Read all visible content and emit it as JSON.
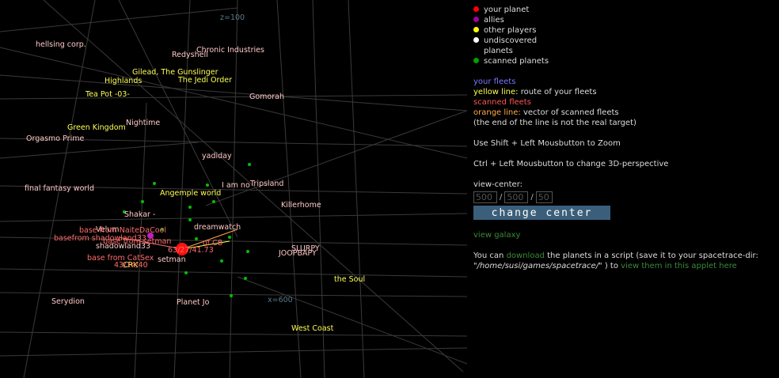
{
  "axis_labels": {
    "z": "z=100",
    "x": "x=600"
  },
  "planets": [
    {
      "name": "hellsing corp.",
      "color": "#ffc8c8"
    },
    {
      "name": "Chronic Industries",
      "color": "#ffc8c8"
    },
    {
      "name": "Redyshell",
      "color": "#ffc8c8"
    },
    {
      "name": "Gilead, The Gunslinger",
      "color": "#ffff55"
    },
    {
      "name": "Highlands",
      "color": "#ffff55"
    },
    {
      "name": "The Jedi Order",
      "color": "#ffff55"
    },
    {
      "name": "Tea Pot -03-",
      "color": "#ffff55"
    },
    {
      "name": "Gomorah",
      "color": "#ffc8c8"
    },
    {
      "name": "Nightime",
      "color": "#ffc8c8"
    },
    {
      "name": "Green Kingdom",
      "color": "#ffff55"
    },
    {
      "name": "Orgasmo Prime",
      "color": "#ffc8c8"
    },
    {
      "name": "yadiday",
      "color": "#ffc8c8"
    },
    {
      "name": "Tripsland",
      "color": "#ffc8c8"
    },
    {
      "name": "I am no",
      "color": "#ffc8c8"
    },
    {
      "name": "final fantasy world",
      "color": "#ffc8c8"
    },
    {
      "name": "Angemple world",
      "color": "#ffff55"
    },
    {
      "name": "Killerhome",
      "color": "#ffc8c8"
    },
    {
      "name": "Shakar -",
      "color": "#ffc8c8"
    },
    {
      "name": "dreamwatch",
      "color": "#ffc8c8"
    },
    {
      "name": "Velum",
      "color": "#ffc8c8"
    },
    {
      "name": "shadowland33",
      "color": "#ffc8c8"
    },
    {
      "name": "SLURPY",
      "color": "#ffc8c8"
    },
    {
      "name": "JOOPBAPY",
      "color": "#ffc8c8"
    },
    {
      "name": "CRK",
      "color": "#ffff55"
    },
    {
      "name": "setman",
      "color": "#ffc8c8"
    },
    {
      "name": "the Soul",
      "color": "#ffff55"
    },
    {
      "name": "Serydion",
      "color": "#ffc8c8"
    },
    {
      "name": "Planet Jo",
      "color": "#ffc8c8"
    },
    {
      "name": "West Coast",
      "color": "#ffff55"
    }
  ],
  "fleet_labels": [
    {
      "text": "base from NaiteDaCool",
      "color": "#ff6b6b"
    },
    {
      "text": "basefrom shadowland33",
      "color": "#ff6b6b"
    },
    {
      "text": "base from setman",
      "color": "#ff6b6b"
    },
    {
      "text": "63/27/41.73",
      "color": "#ff6b6b"
    },
    {
      "text": "base from CatSex",
      "color": "#ff6b6b"
    },
    {
      "text": "43/14/40",
      "color": "#ff6b6b"
    },
    {
      "text": "of CB",
      "color": "#ff6b6b"
    }
  ],
  "legend": [
    {
      "label": "your planet",
      "color": "#ff0000"
    },
    {
      "label": "allies",
      "color": "#a000a0"
    },
    {
      "label": "other players",
      "color": "#ffff00"
    },
    {
      "label": "undiscovered planets",
      "color": "#ffffff"
    },
    {
      "label": "scanned planets",
      "color": "#00a000"
    }
  ],
  "colors": {
    "your_fleets": "#7777ff",
    "yellow": "#ffff55",
    "scanned": "#ff5555",
    "orange": "#ffaa44"
  },
  "info": {
    "your_fleets": "your fleets",
    "yellow_line": "yellow line:",
    "yellow_line_desc": " route of your fleets",
    "scanned_fleets": "scanned fleets",
    "orange_line": "orange line:",
    "orange_line_desc": " vector of scanned fleets",
    "orange_note": "(the end of the line is not the real target)",
    "zoom_hint": "Use Shift + Left Mousbutton to Zoom",
    "persp_hint": "Ctrl + Left Mousbutton to change 3D-perspective",
    "view_center": "view-center:",
    "cx": "500",
    "cy": "500",
    "cz": "50",
    "sep": "/",
    "change_center": "change center",
    "view_galaxy": "view galaxy",
    "dl_1": "You can ",
    "dl_link": "download",
    "dl_2": " the planets in a script (save it to your spacetrace-dir:",
    "dl_path": "\"/home/susi/games/spacetrace/\"",
    "dl_3": " ) to ",
    "dl_link2": "view them in this applet here"
  }
}
